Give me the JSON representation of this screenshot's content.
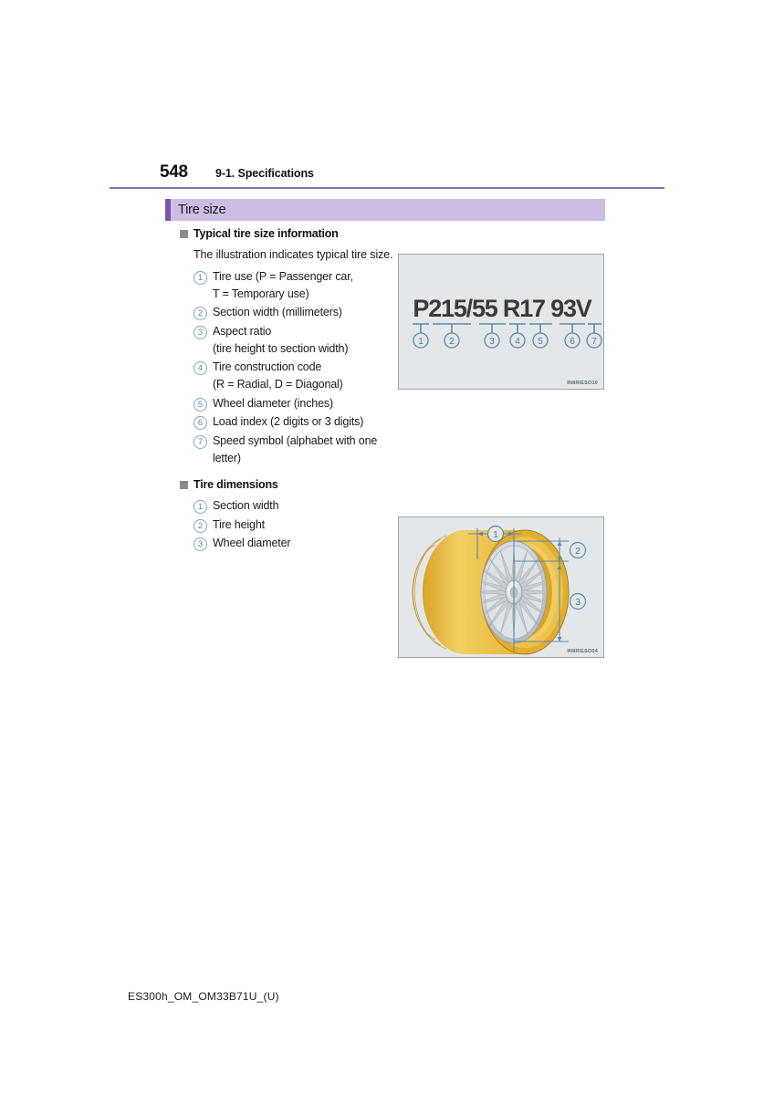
{
  "page": {
    "number": "548",
    "section": "9-1. Specifications",
    "footer_code": "ES300h_OM_OM33B71U_(U)"
  },
  "section_title": "Tire size",
  "blocks": [
    {
      "heading": "Typical tire size information",
      "paragraph": "The illustration indicates typical tire size.",
      "items": [
        {
          "num": "1",
          "text": "Tire use (P = Passenger car,\nT = Temporary use)"
        },
        {
          "num": "2",
          "text": "Section width (millimeters)"
        },
        {
          "num": "3",
          "text": "Aspect ratio\n(tire height to section width)"
        },
        {
          "num": "4",
          "text": "Tire construction code\n(R = Radial, D = Diagonal)"
        },
        {
          "num": "5",
          "text": "Wheel diameter (inches)"
        },
        {
          "num": "6",
          "text": "Load index (2 digits or 3 digits)"
        },
        {
          "num": "7",
          "text": "Speed symbol (alphabet with one letter)"
        }
      ]
    },
    {
      "heading": "Tire dimensions",
      "paragraph": "",
      "items": [
        {
          "num": "1",
          "text": "Section width"
        },
        {
          "num": "2",
          "text": "Tire height"
        },
        {
          "num": "3",
          "text": "Wheel diameter"
        }
      ]
    }
  ],
  "illustrations": {
    "tire_size": {
      "code_text": "P215/55 R17 93V",
      "callout_numbers": [
        "1",
        "2",
        "3",
        "4",
        "5",
        "6",
        "7"
      ],
      "reference_code": "IN8RIESO10"
    },
    "tire_dimensions": {
      "callout_numbers": [
        "1",
        "2",
        "3"
      ],
      "reference_code": "IN8RIESO04",
      "tire_color": "#e8b93c",
      "wheel_color": "#c9ced4",
      "dimension_line_color": "#5e8ca6"
    }
  },
  "colors": {
    "accent_bar": "#7b55ad",
    "section_background": "#cdbde5",
    "header_rule": "#8a6fb0",
    "circle_number": "#5e8ca6",
    "illustration_background": "#e3e7ea"
  }
}
